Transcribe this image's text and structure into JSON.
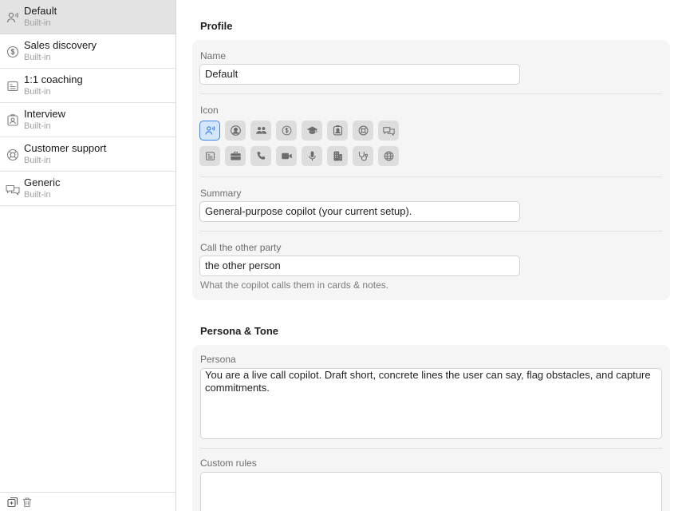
{
  "sidebar": {
    "items": [
      {
        "title": "Default",
        "subtitle": "Built-in",
        "icon": "person-speaking-icon",
        "selected": true
      },
      {
        "title": "Sales discovery",
        "subtitle": "Built-in",
        "icon": "dollar-circle-icon"
      },
      {
        "title": "1:1 coaching",
        "subtitle": "Built-in",
        "icon": "text-document-icon"
      },
      {
        "title": "Interview",
        "subtitle": "Built-in",
        "icon": "person-badge-icon"
      },
      {
        "title": "Customer support",
        "subtitle": "Built-in",
        "icon": "lifebuoy-icon"
      },
      {
        "title": "Generic",
        "subtitle": "Built-in",
        "icon": "chat-bubbles-icon"
      }
    ],
    "footer": {
      "add_icon": "add-duplicate-icon",
      "delete_icon": "trash-icon"
    }
  },
  "profile": {
    "section_title": "Profile",
    "name_label": "Name",
    "name_value": "Default",
    "icon_label": "Icon",
    "icons": [
      "person-speaking-icon",
      "person-circle-icon",
      "two-people-icon",
      "dollar-circle-icon",
      "graduation-cap-icon",
      "person-badge-icon",
      "lifebuoy-icon",
      "chat-bubbles-icon",
      "text-document-icon",
      "briefcase-icon",
      "phone-icon",
      "video-camera-icon",
      "microphone-icon",
      "building-icon",
      "stethoscope-icon",
      "globe-icon"
    ],
    "selected_icon": "person-speaking-icon",
    "summary_label": "Summary",
    "summary_value": "General-purpose copilot (your current setup).",
    "other_party_label": "Call the other party",
    "other_party_value": "the other person",
    "other_party_hint": "What the copilot calls them in cards & notes."
  },
  "persona": {
    "section_title": "Persona & Tone",
    "persona_label": "Persona",
    "persona_value": "You are a live call copilot. Draft short, concrete lines the user can say, flag obstacles, and capture commitments.",
    "custom_rules_label": "Custom rules",
    "custom_rules_value": ""
  },
  "colors": {
    "accent": "#2f7ae0",
    "selected_row": "#e3e3e3",
    "card_bg": "#f5f5f5"
  }
}
